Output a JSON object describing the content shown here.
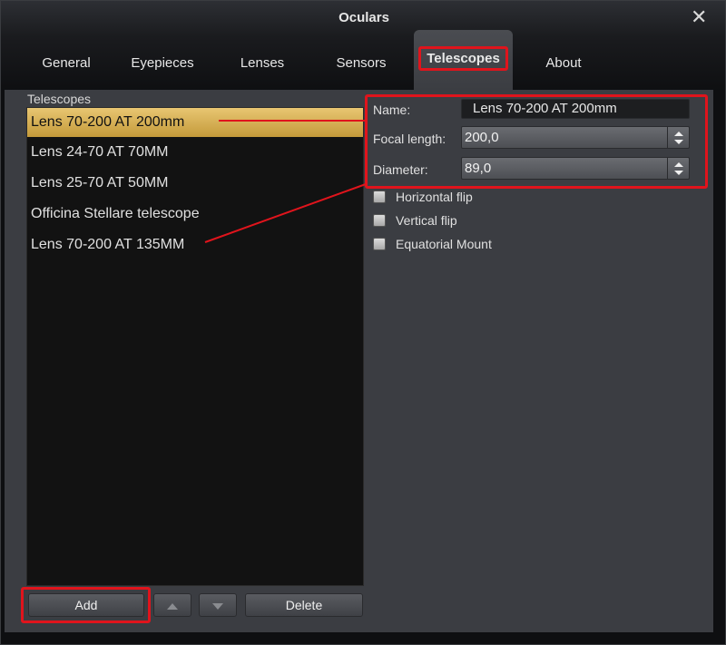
{
  "window": {
    "title": "Oculars",
    "close_icon": "close-icon"
  },
  "tabs": [
    {
      "label": "General"
    },
    {
      "label": "Eyepieces"
    },
    {
      "label": "Lenses"
    },
    {
      "label": "Sensors"
    },
    {
      "label": "Telescopes",
      "active": true
    },
    {
      "label": "About"
    }
  ],
  "list": {
    "caption": "Telescopes",
    "items": [
      "Lens 70-200 AT 200mm",
      "Lens 24-70 AT 70MM",
      "Lens 25-70 AT 50MM",
      "Officina Stellare telescope",
      "Lens 70-200 AT 135MM"
    ],
    "selected_index": 0
  },
  "buttons": {
    "add": "Add",
    "delete": "Delete",
    "move_up_icon": "arrow-up-icon",
    "move_down_icon": "arrow-down-icon"
  },
  "form": {
    "name_label": "Name:",
    "name_value": "Lens 70-200 AT 200mm",
    "focal_label": "Focal length:",
    "focal_value": "200,0",
    "diameter_label": "Diameter:",
    "diameter_value": "89,0",
    "checks": [
      {
        "label": "Horizontal flip",
        "checked": false
      },
      {
        "label": "Vertical flip",
        "checked": false
      },
      {
        "label": "Equatorial Mount",
        "checked": false
      }
    ]
  },
  "colors": {
    "highlight": "#e0141c",
    "selection": "#e8c672",
    "panel": "#3b3d42"
  }
}
